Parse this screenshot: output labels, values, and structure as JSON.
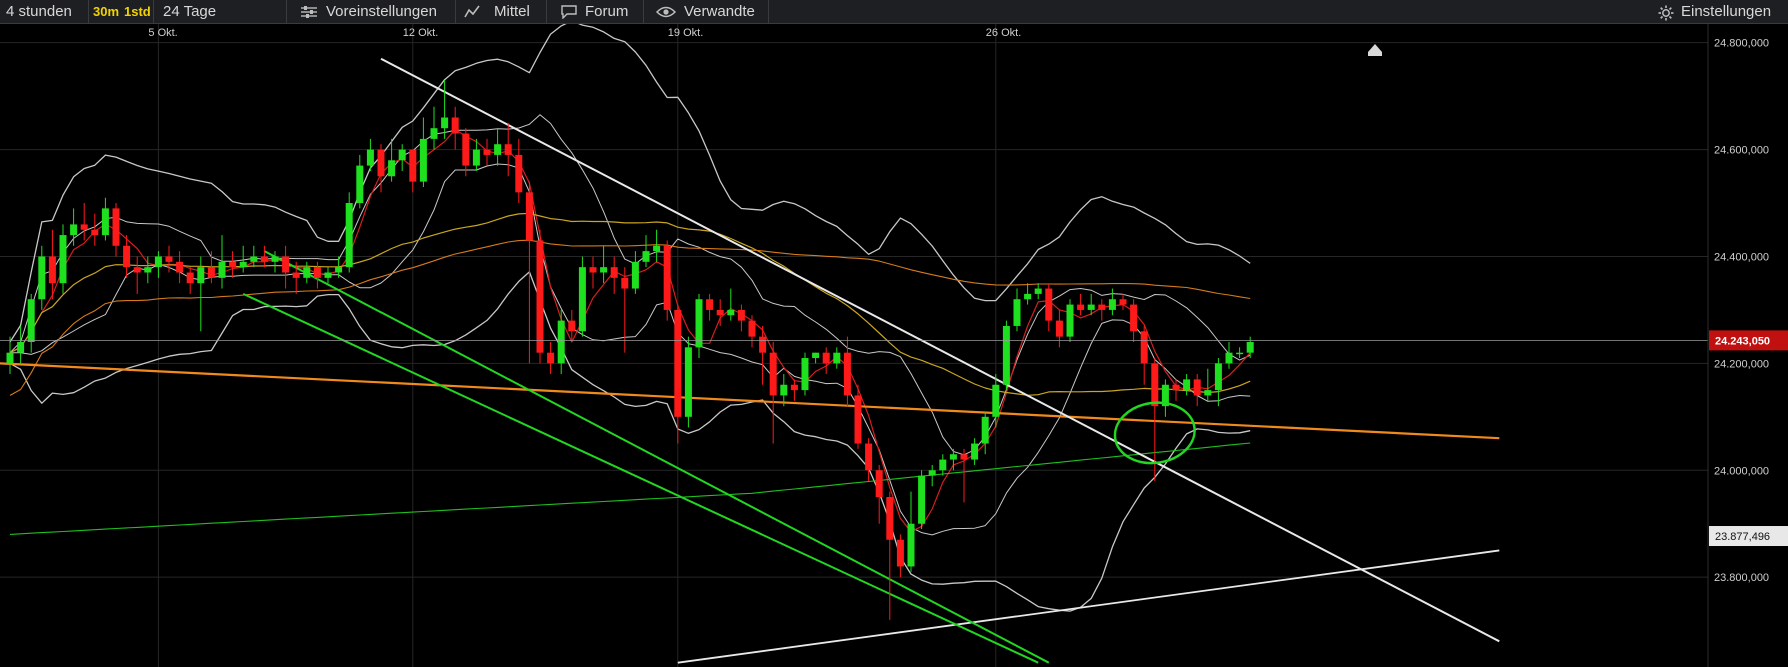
{
  "toolbar": {
    "range_select": "4 stunden",
    "interval_30m": "30m",
    "interval_1std": "1std",
    "period": "24 Tage",
    "presets_label": "Voreinstellungen",
    "indicator_label": "Mittel",
    "forum_label": "Forum",
    "related_label": "Verwandte",
    "settings_label": "Einstellungen"
  },
  "colors": {
    "up": "#1ee01e",
    "down": "#ff1a1a",
    "band": "#c8c8c8",
    "ma_fast": "#d81e1e",
    "ma_yellow": "#c9a521",
    "ma_orange_thin": "#d47a1c",
    "ma_green": "#1fbf1f",
    "trend_orange": "#f08a1c",
    "trend_white": "#e8e8e8",
    "trend_green": "#22d622",
    "price_badge_bg": "#c01010"
  },
  "chart_data": {
    "type": "candlestick",
    "x_labels": [
      "5 Okt.",
      "12 Okt.",
      "19 Okt.",
      "26 Okt."
    ],
    "y_labels": [
      "24.800,000",
      "24.600,000",
      "24.400,000",
      "24.200,000",
      "24.000,000",
      "23.800,000"
    ],
    "ylim": [
      23.66,
      24.805
    ],
    "current_price_label": "24.243,050",
    "current_price": 24.243,
    "marker_price_label": "23.877,496",
    "marker_price": 23.877,
    "candles": [
      [
        24.2,
        24.22,
        24.25,
        24.18
      ],
      [
        24.22,
        24.24,
        24.27,
        24.2
      ],
      [
        24.24,
        24.32,
        24.33,
        24.22
      ],
      [
        24.32,
        24.4,
        24.42,
        24.3
      ],
      [
        24.4,
        24.35,
        24.45,
        24.32
      ],
      [
        24.35,
        24.44,
        24.46,
        24.33
      ],
      [
        24.44,
        24.46,
        24.49,
        24.42
      ],
      [
        24.46,
        24.45,
        24.5,
        24.43
      ],
      [
        24.45,
        24.44,
        24.48,
        24.42
      ],
      [
        24.44,
        24.49,
        24.51,
        24.43
      ],
      [
        24.49,
        24.42,
        24.5,
        24.4
      ],
      [
        24.42,
        24.38,
        24.44,
        24.36
      ],
      [
        24.38,
        24.37,
        24.4,
        24.33
      ],
      [
        24.37,
        24.38,
        24.4,
        24.35
      ],
      [
        24.38,
        24.4,
        24.41,
        24.36
      ],
      [
        24.4,
        24.39,
        24.42,
        24.37
      ],
      [
        24.39,
        24.37,
        24.41,
        24.35
      ],
      [
        24.37,
        24.35,
        24.38,
        24.33
      ],
      [
        24.35,
        24.38,
        24.4,
        24.26
      ],
      [
        24.38,
        24.36,
        24.41,
        24.35
      ],
      [
        24.36,
        24.39,
        24.44,
        24.34
      ],
      [
        24.39,
        24.38,
        24.41,
        24.36
      ],
      [
        24.38,
        24.39,
        24.42,
        24.37
      ],
      [
        24.39,
        24.4,
        24.42,
        24.38
      ],
      [
        24.4,
        24.39,
        24.42,
        24.38
      ],
      [
        24.39,
        24.4,
        24.41,
        24.37
      ],
      [
        24.4,
        24.37,
        24.42,
        24.34
      ],
      [
        24.37,
        24.36,
        24.39,
        24.33
      ],
      [
        24.36,
        24.38,
        24.39,
        24.35
      ],
      [
        24.38,
        24.36,
        24.39,
        24.34
      ],
      [
        24.36,
        24.37,
        24.38,
        24.35
      ],
      [
        24.37,
        24.38,
        24.4,
        24.36
      ],
      [
        24.38,
        24.5,
        24.52,
        24.37
      ],
      [
        24.5,
        24.57,
        24.59,
        24.49
      ],
      [
        24.57,
        24.6,
        24.62,
        24.56
      ],
      [
        24.6,
        24.55,
        24.61,
        24.52
      ],
      [
        24.55,
        24.58,
        24.62,
        24.54
      ],
      [
        24.58,
        24.6,
        24.61,
        24.56
      ],
      [
        24.6,
        24.54,
        24.6,
        24.52
      ],
      [
        24.54,
        24.62,
        24.66,
        24.53
      ],
      [
        24.62,
        24.64,
        24.68,
        24.6
      ],
      [
        24.64,
        24.66,
        24.73,
        24.62
      ],
      [
        24.66,
        24.63,
        24.68,
        24.6
      ],
      [
        24.63,
        24.57,
        24.64,
        24.55
      ],
      [
        24.57,
        24.6,
        24.62,
        24.56
      ],
      [
        24.6,
        24.59,
        24.62,
        24.57
      ],
      [
        24.59,
        24.61,
        24.64,
        24.57
      ],
      [
        24.61,
        24.59,
        24.65,
        24.55
      ],
      [
        24.59,
        24.52,
        24.62,
        24.5
      ],
      [
        24.52,
        24.43,
        24.54,
        24.2
      ],
      [
        24.43,
        24.22,
        24.45,
        24.2
      ],
      [
        24.22,
        24.2,
        24.24,
        24.18
      ],
      [
        24.2,
        24.28,
        24.3,
        24.18
      ],
      [
        24.28,
        24.26,
        24.3,
        24.24
      ],
      [
        24.26,
        24.38,
        24.4,
        24.25
      ],
      [
        24.38,
        24.37,
        24.4,
        24.34
      ],
      [
        24.37,
        24.38,
        24.42,
        24.35
      ],
      [
        24.38,
        24.36,
        24.4,
        24.33
      ],
      [
        24.36,
        24.34,
        24.38,
        24.22
      ],
      [
        24.34,
        24.39,
        24.41,
        24.33
      ],
      [
        24.39,
        24.41,
        24.44,
        24.38
      ],
      [
        24.41,
        24.42,
        24.45,
        24.39
      ],
      [
        24.42,
        24.3,
        24.43,
        24.28
      ],
      [
        24.3,
        24.1,
        24.31,
        24.05
      ],
      [
        24.1,
        24.23,
        24.25,
        24.08
      ],
      [
        24.23,
        24.32,
        24.33,
        24.21
      ],
      [
        24.32,
        24.3,
        24.33,
        24.28
      ],
      [
        24.3,
        24.29,
        24.32,
        24.27
      ],
      [
        24.29,
        24.3,
        24.34,
        24.28
      ],
      [
        24.3,
        24.28,
        24.31,
        24.26
      ],
      [
        24.28,
        24.25,
        24.29,
        24.23
      ],
      [
        24.25,
        24.22,
        24.27,
        24.16
      ],
      [
        24.22,
        24.14,
        24.24,
        24.05
      ],
      [
        24.14,
        24.16,
        24.18,
        24.12
      ],
      [
        24.16,
        24.15,
        24.17,
        24.13
      ],
      [
        24.15,
        24.21,
        24.22,
        24.14
      ],
      [
        24.21,
        24.22,
        24.22,
        24.2
      ],
      [
        24.22,
        24.2,
        24.23,
        24.18
      ],
      [
        24.2,
        24.22,
        24.23,
        24.19
      ],
      [
        24.22,
        24.14,
        24.25,
        24.12
      ],
      [
        24.14,
        24.05,
        24.16,
        24.04
      ],
      [
        24.05,
        24.0,
        24.06,
        23.98
      ],
      [
        24.0,
        23.95,
        24.01,
        23.9
      ],
      [
        23.95,
        23.87,
        23.96,
        23.72
      ],
      [
        23.87,
        23.82,
        23.88,
        23.8
      ],
      [
        23.82,
        23.9,
        23.96,
        23.81
      ],
      [
        23.9,
        23.99,
        24.0,
        23.89
      ],
      [
        23.99,
        24.0,
        24.01,
        23.97
      ],
      [
        24.0,
        24.02,
        24.03,
        23.99
      ],
      [
        24.02,
        24.03,
        24.04,
        24.0
      ],
      [
        24.03,
        24.02,
        24.04,
        23.94
      ],
      [
        24.02,
        24.05,
        24.06,
        24.01
      ],
      [
        24.05,
        24.1,
        24.11,
        24.03
      ],
      [
        24.1,
        24.16,
        24.18,
        24.08
      ],
      [
        24.16,
        24.27,
        24.28,
        24.15
      ],
      [
        24.27,
        24.32,
        24.34,
        24.26
      ],
      [
        24.32,
        24.33,
        24.35,
        24.31
      ],
      [
        24.33,
        24.34,
        24.35,
        24.32
      ],
      [
        24.34,
        24.28,
        24.35,
        24.26
      ],
      [
        24.28,
        24.25,
        24.3,
        24.23
      ],
      [
        24.25,
        24.31,
        24.32,
        24.24
      ],
      [
        24.31,
        24.3,
        24.33,
        24.29
      ],
      [
        24.3,
        24.31,
        24.33,
        24.29
      ],
      [
        24.31,
        24.3,
        24.32,
        24.28
      ],
      [
        24.3,
        24.32,
        24.34,
        24.29
      ],
      [
        24.32,
        24.31,
        24.33,
        24.3
      ],
      [
        24.31,
        24.26,
        24.32,
        24.24
      ],
      [
        24.26,
        24.2,
        24.27,
        24.16
      ],
      [
        24.2,
        24.12,
        24.21,
        23.98
      ],
      [
        24.12,
        24.16,
        24.17,
        24.1
      ],
      [
        24.16,
        24.15,
        24.17,
        24.13
      ],
      [
        24.15,
        24.17,
        24.18,
        24.14
      ],
      [
        24.17,
        24.14,
        24.18,
        24.12
      ],
      [
        24.14,
        24.15,
        24.19,
        24.13
      ],
      [
        24.15,
        24.2,
        24.21,
        24.12
      ],
      [
        24.2,
        24.22,
        24.24,
        24.19
      ],
      [
        24.22,
        24.22,
        24.23,
        24.21
      ],
      [
        24.22,
        24.24,
        24.25,
        24.21
      ]
    ],
    "x_label_candle_index": [
      14,
      38,
      63,
      93
    ],
    "resistance_marker_index": 108
  }
}
